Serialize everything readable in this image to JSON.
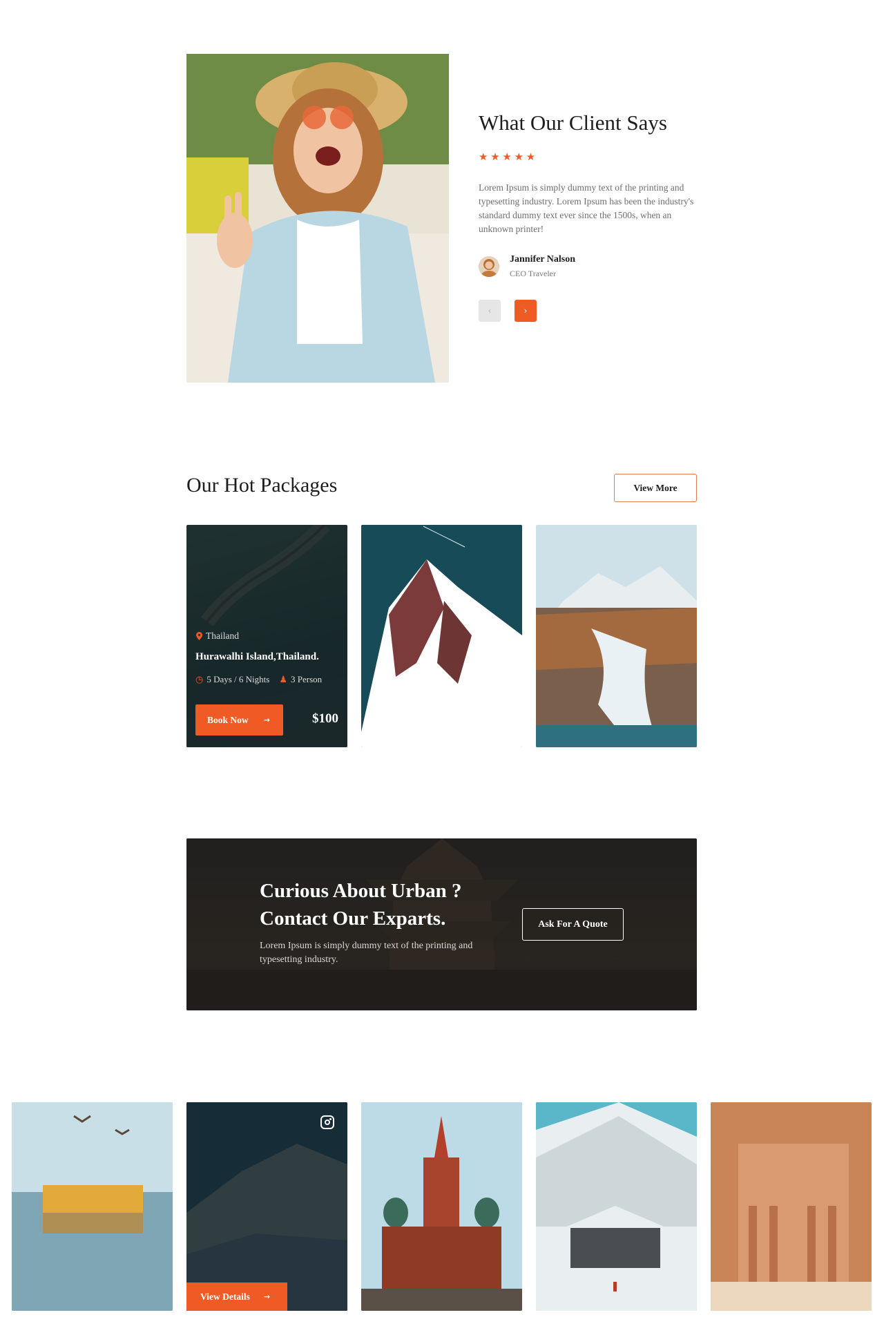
{
  "testimonial": {
    "title": "What Our Client Says",
    "rating": 5,
    "stars": "★ ★ ★ ★ ★",
    "text": "Lorem Ipsum is simply dummy text of the printing and typesetting industry. Lorem Ipsum has been the industry's standard dummy text ever since the 1500s, when an unknown printer!",
    "author_name": "Jannifer Nalson",
    "author_role": "CEO Traveler",
    "prev_icon": "‹",
    "next_icon": "›"
  },
  "packages": {
    "title": "Our Hot Packages",
    "view_more_label": "View More",
    "featured": {
      "location": "Thailand",
      "name": "Hurawalhi Island,Thailand.",
      "duration": "5 Days / 6 Nights",
      "people": "3 Person",
      "book_label": "Book Now",
      "price": "$100"
    }
  },
  "cta": {
    "heading_line1": "Curious About Urban ?",
    "heading_line2": "Contact Our Exparts.",
    "text": "Lorem Ipsum is simply dummy text of the printing and typesetting industry.",
    "button_label": "Ask For A Quote"
  },
  "gallery": {
    "view_details_label": "View Details"
  },
  "colors": {
    "accent": "#f05a24",
    "heading": "#1d1d1d",
    "body_text": "#6f6f6f"
  }
}
